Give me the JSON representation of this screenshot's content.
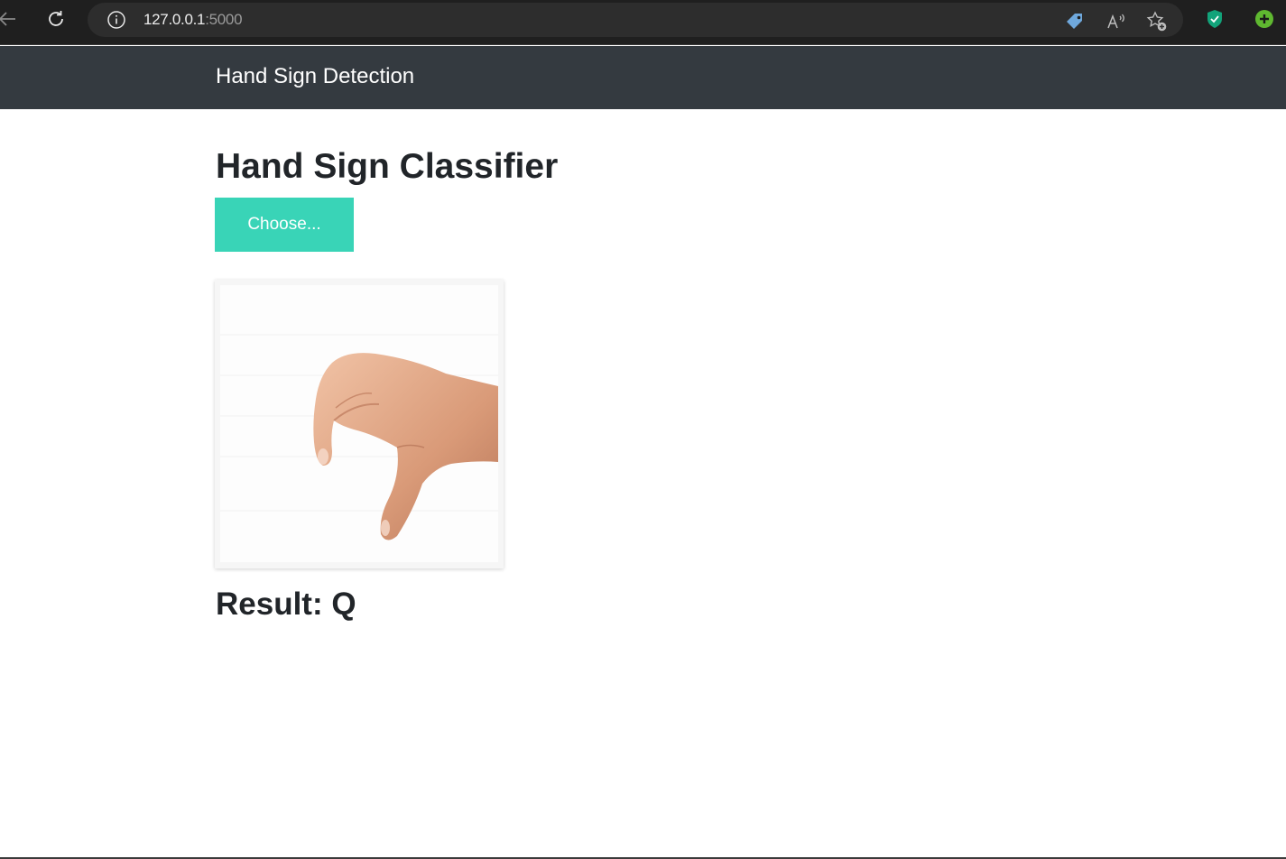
{
  "browser": {
    "url_host": "127.0.0.1",
    "url_port": ":5000",
    "icons": [
      "back-arrow-icon",
      "refresh-icon",
      "info-icon",
      "price-tag-icon",
      "read-aloud-icon",
      "favorite-add-icon",
      "shield-extension-icon",
      "add-extension-icon"
    ],
    "accent_colors": {
      "tag": "#6fa8dc",
      "shield": "#12a37a",
      "add": "#5fb830"
    }
  },
  "navbar": {
    "brand": "Hand Sign Detection",
    "background": "#343a40"
  },
  "main": {
    "title": "Hand Sign Classifier",
    "choose_label": "Choose...",
    "button_color": "#39d4b7",
    "result_label": "Result:",
    "result_value": "Q"
  }
}
